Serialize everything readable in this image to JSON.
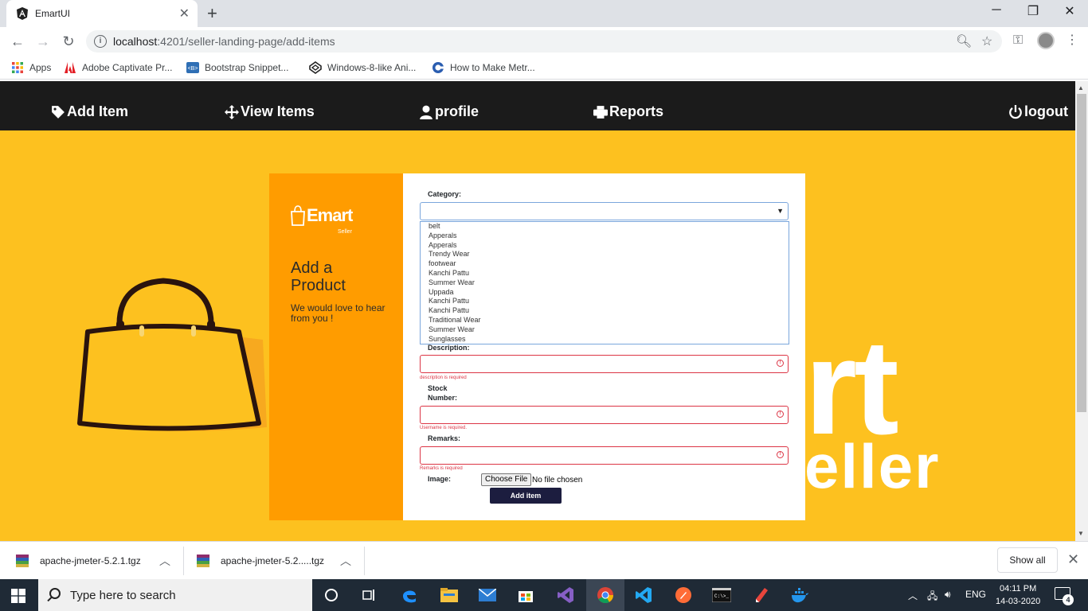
{
  "browser": {
    "tab_title": "EmartUI",
    "url_host": "localhost",
    "url_path": ":4201/seller-landing-page/add-items",
    "bookmarks": [
      {
        "label": "Apps",
        "icon": "apps-grid-icon"
      },
      {
        "label": "Adobe Captivate Pr...",
        "icon": "adobe-icon"
      },
      {
        "label": "Bootstrap Snippet...",
        "icon": "bootstrap-icon"
      },
      {
        "label": "Windows-8-like Ani...",
        "icon": "codepen-icon"
      },
      {
        "label": "How to Make Metr...",
        "icon": "site-icon"
      }
    ]
  },
  "nav": {
    "add_item": "Add Item",
    "view_items": "View Items",
    "profile": "profile",
    "reports": "Reports",
    "logout": "logout"
  },
  "background": {
    "big_text_top": "rt",
    "big_text_bottom": "eller"
  },
  "card": {
    "brand_name": "Emart",
    "brand_sub": "Seller",
    "title": "Add a Product",
    "subtitle": "We would love to hear from you !"
  },
  "form": {
    "category_label": "Category:",
    "category_value": "",
    "category_options": [
      "belt",
      "Apperals",
      "Apperals",
      "Trendy Wear",
      "footwear",
      "Kanchi Pattu",
      "Summer Wear",
      "Uppada",
      "Kanchi Pattu",
      "Kanchi Pattu",
      "Traditional Wear",
      "Summer Wear",
      "Sunglasses"
    ],
    "description_label": "Description:",
    "description_error": "description is required",
    "stock_label_1": "Stock",
    "stock_label_2": "Number:",
    "stock_error": "Username is required.",
    "remarks_label": "Remarks:",
    "remarks_error": "Remarks is required",
    "image_label": "Image:",
    "file_button": "Choose File",
    "file_status": "No file chosen",
    "submit": "Add item"
  },
  "downloads": {
    "items": [
      "apache-jmeter-5.2.1.tgz",
      "apache-jmeter-5.2.....tgz"
    ],
    "show_all": "Show all"
  },
  "taskbar": {
    "search_placeholder": "Type here to search",
    "language": "ENG",
    "time": "04:11 PM",
    "date": "14-03-2020",
    "notification_count": "4"
  },
  "colors": {
    "page_bg": "#fdc11f",
    "navbar_bg": "#1b1b1b",
    "card_left": "#ff9c00",
    "submit_bg": "#1c1d3f",
    "error": "#dc3545"
  }
}
